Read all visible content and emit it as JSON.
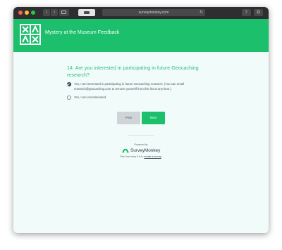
{
  "browser": {
    "url": "surveymonkey.com",
    "reload_icon": "↻",
    "back_glyph": "‹",
    "forward_glyph": "›",
    "share_glyph": "⇧",
    "tabs_glyph": "⧉"
  },
  "colors": {
    "brand_green": "#1cbf6b",
    "question_green": "#2dbd84",
    "page_background": "#f1fbf9"
  },
  "survey": {
    "title": "Mystery at the Museum Feedback"
  },
  "question": {
    "number_and_text": "14. Are you interested in participating in future Geocaching research?",
    "options": [
      {
        "label": "Yes, I am interested in participating in future Geocaching research. (You can email research@geocaching.com to remove yourself from this list at any time.)",
        "selected": true
      },
      {
        "label": "Yes, I am not interested",
        "selected": false
      }
    ]
  },
  "navigation": {
    "prev_label": "Prev",
    "next_label": "Next"
  },
  "footer": {
    "powered_by": "Powered by",
    "brand_name": "SurveyMonkey",
    "tagline_prefix": "See how easy it is to",
    "tagline_link": "create a survey",
    "tagline_suffix": "."
  }
}
